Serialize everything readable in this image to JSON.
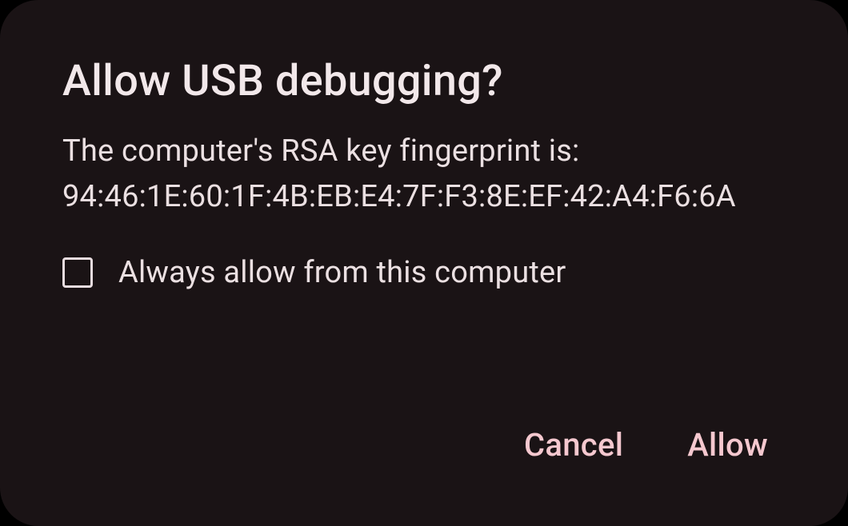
{
  "dialog": {
    "title": "Allow USB debugging?",
    "body_intro": "The computer's RSA key fingerprint is:",
    "fingerprint": "94:46:1E:60:1F:4B:EB:E4:7F:F3:8E:EF:42:A4:F6:6A",
    "checkbox": {
      "label": "Always allow from this computer",
      "checked": false
    },
    "actions": {
      "cancel": "Cancel",
      "allow": "Allow"
    }
  },
  "colors": {
    "background": "#1a1315",
    "text_primary": "#f2e8ea",
    "text_body": "#ebe0e2",
    "accent": "#f5c8cf"
  }
}
